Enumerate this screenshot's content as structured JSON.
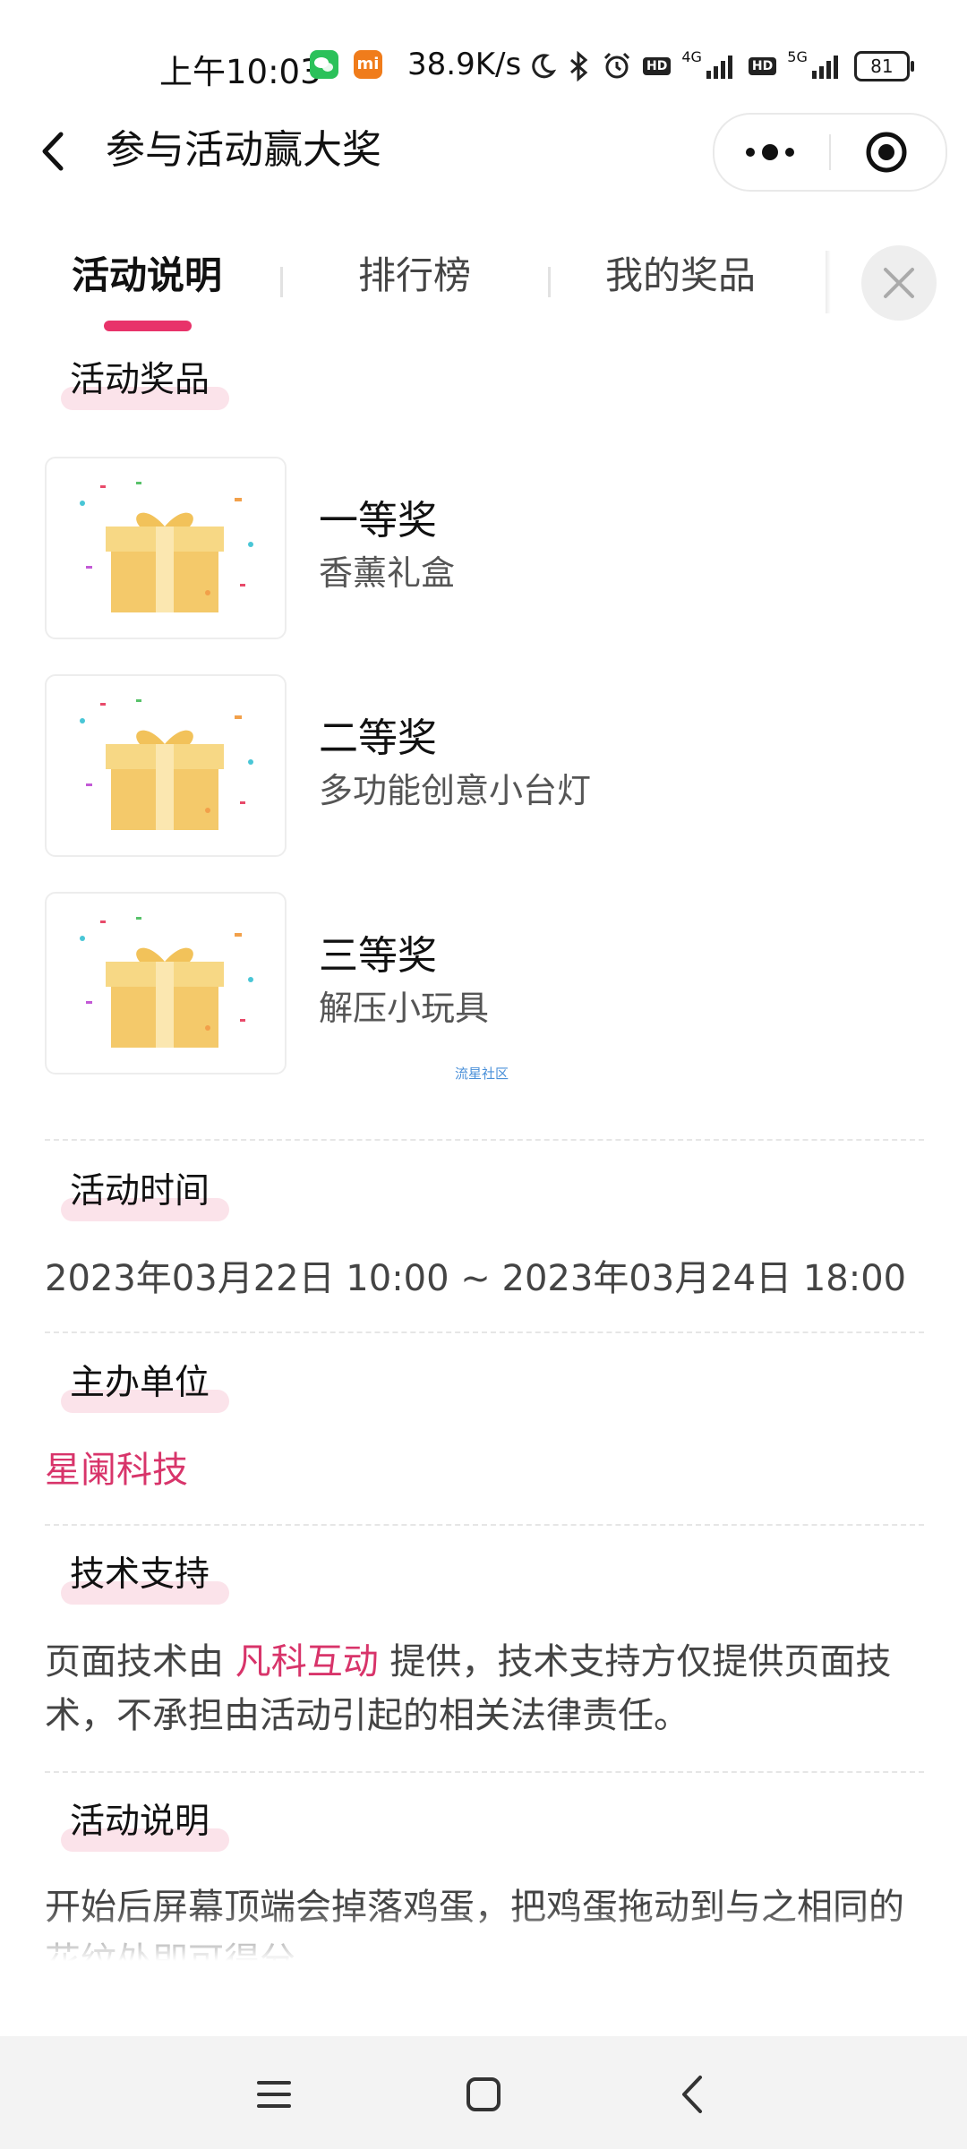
{
  "status_bar": {
    "time": "上午10:03",
    "speed": "38.9K/s",
    "network_4g": "4G",
    "network_5g": "5G",
    "hd": "HD",
    "battery": "81",
    "mi_label": "mi"
  },
  "nav": {
    "title": "参与活动赢大奖"
  },
  "tabs": [
    {
      "label": "活动说明"
    },
    {
      "label": "排行榜"
    },
    {
      "label": "我的奖品"
    }
  ],
  "prizes": {
    "section_title": "活动奖品",
    "items": [
      {
        "rank": "一等奖",
        "name": "香薰礼盒"
      },
      {
        "rank": "二等奖",
        "name": "多功能创意小台灯"
      },
      {
        "rank": "三等奖",
        "name": "解压小玩具"
      }
    ],
    "watermark": "流星社区"
  },
  "time_section": {
    "title": "活动时间",
    "value": "2023年03月22日 10:00 ~ 2023年03月24日 18:00"
  },
  "organizer_section": {
    "title": "主办单位",
    "value": "星阑科技"
  },
  "tech_section": {
    "title": "技术支持",
    "prefix": "页面技术由 ",
    "provider": "凡科互动",
    "suffix": " 提供，技术支持方仅提供页面技术，不承担由活动引起的相关法律责任。"
  },
  "desc_section": {
    "title": "活动说明",
    "text": "开始后屏幕顶端会掉落鸡蛋，把鸡蛋拖动到与之相同的花纹处即可得分"
  },
  "colors": {
    "accent": "#e8336a",
    "link": "#d8346a",
    "highlight": "#fbe3ea"
  }
}
